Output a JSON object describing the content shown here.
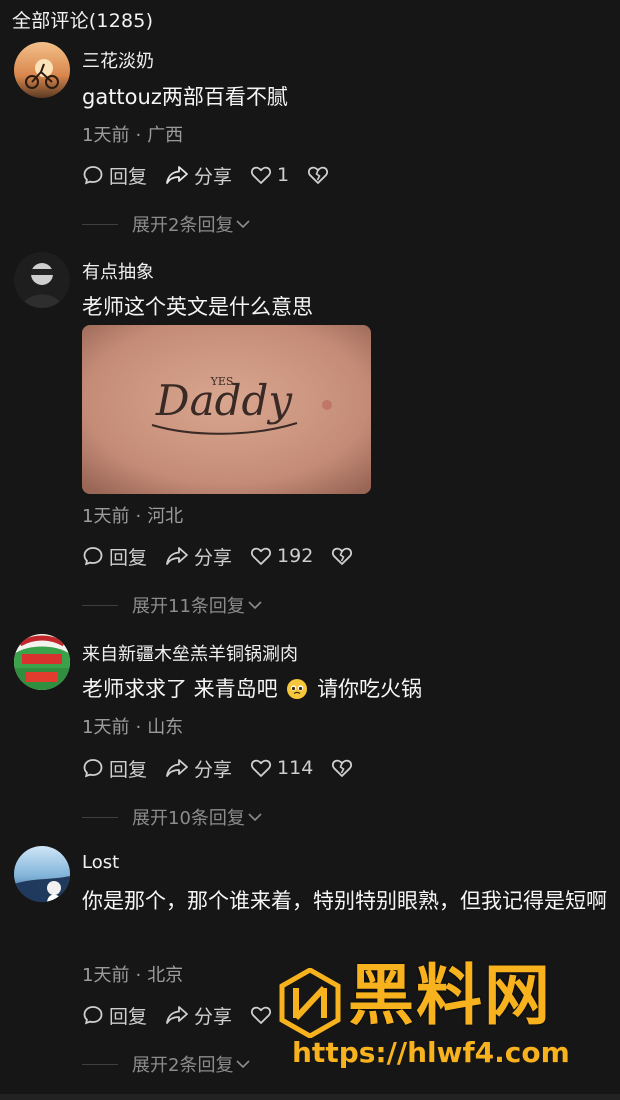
{
  "header": {
    "title": "全部评论(1285)"
  },
  "comments": [
    {
      "username": "三花淡奶",
      "text": "gattouz两部百看不腻",
      "time": "1天前",
      "location": "广西",
      "reply_label": "回复",
      "share_label": "分享",
      "likes": "1",
      "replies_label": "展开2条回复"
    },
    {
      "username": "有点抽象",
      "text": "老师这个英文是什么意思",
      "image_text": "Daddy",
      "image_small": "YES",
      "time": "1天前",
      "location": "河北",
      "reply_label": "回复",
      "share_label": "分享",
      "likes": "192",
      "replies_label": "展开11条回复"
    },
    {
      "username": "来自新疆木垒羔羊铜锅涮肉",
      "text_before": "老师求求了 来青岛吧",
      "text_after": "请你吃火锅",
      "time": "1天前",
      "location": "山东",
      "reply_label": "回复",
      "share_label": "分享",
      "likes": "114",
      "replies_label": "展开10条回复"
    },
    {
      "username": "Lost",
      "text": "你是那个，那个谁来着，特别特别眼熟，但我记得是短啊",
      "time": "1天前",
      "location": "北京",
      "reply_label": "回复",
      "share_label": "分享",
      "replies_label": "展开2条回复"
    }
  ],
  "watermark": {
    "title": "黑料网",
    "url": "https://hlwf4.com"
  },
  "colors": {
    "accent": "#f7b21e",
    "background": "#161616",
    "muted": "#9c9c9c"
  }
}
